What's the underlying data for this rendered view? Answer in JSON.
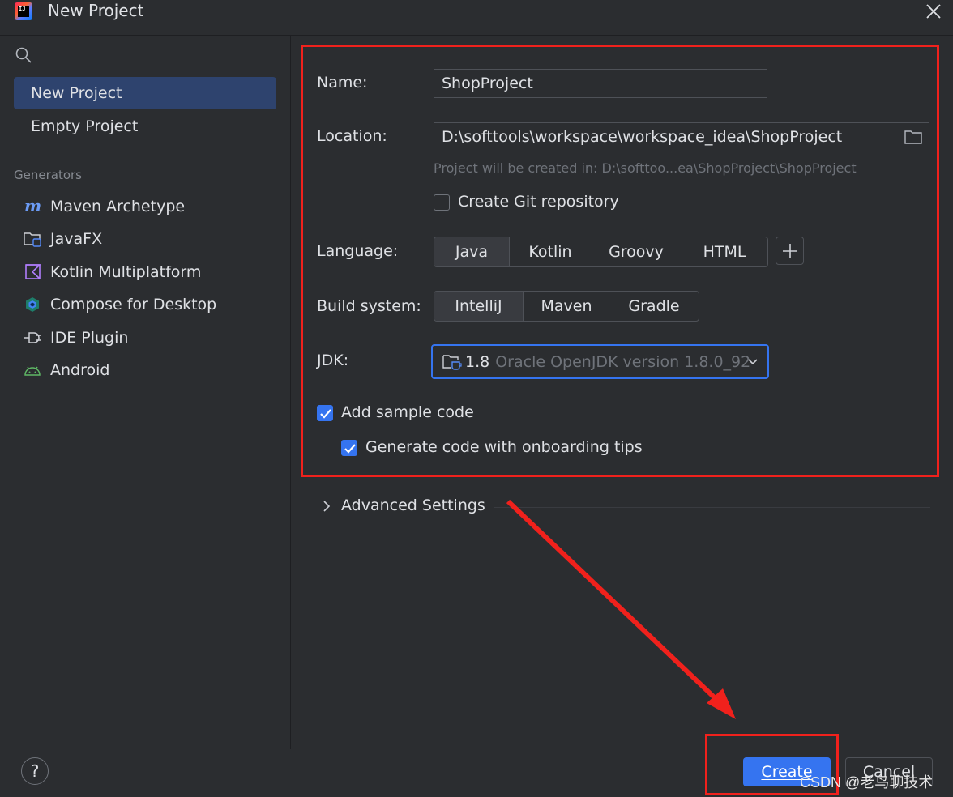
{
  "window": {
    "title": "New Project"
  },
  "sidebar": {
    "top_items": [
      {
        "label": "New Project",
        "selected": true
      },
      {
        "label": "Empty Project",
        "selected": false
      }
    ],
    "generators_label": "Generators",
    "generators": [
      {
        "label": "Maven Archetype",
        "icon": "maven-icon"
      },
      {
        "label": "JavaFX",
        "icon": "javafx-icon"
      },
      {
        "label": "Kotlin Multiplatform",
        "icon": "kotlin-icon"
      },
      {
        "label": "Compose for Desktop",
        "icon": "compose-icon"
      },
      {
        "label": "IDE Plugin",
        "icon": "plugin-icon"
      },
      {
        "label": "Android",
        "icon": "android-icon"
      }
    ]
  },
  "form": {
    "name_label": "Name:",
    "name_value": "ShopProject",
    "location_label": "Location:",
    "location_value": "D:\\softtools\\workspace\\workspace_idea\\ShopProject",
    "location_hint": "Project will be created in: D:\\softtoo...ea\\ShopProject\\ShopProject",
    "git_label": "Create Git repository",
    "git_checked": false,
    "language_label": "Language:",
    "languages": [
      "Java",
      "Kotlin",
      "Groovy",
      "HTML"
    ],
    "language_selected": "Java",
    "build_label": "Build system:",
    "build_systems": [
      "IntelliJ",
      "Maven",
      "Gradle"
    ],
    "build_selected": "IntelliJ",
    "jdk_label": "JDK:",
    "jdk_version": "1.8",
    "jdk_desc": "Oracle OpenJDK version 1.8.0_92",
    "sample_code_label": "Add sample code",
    "sample_code_checked": true,
    "onboarding_label": "Generate code with onboarding tips",
    "onboarding_checked": true,
    "advanced_label": "Advanced Settings"
  },
  "footer": {
    "help_label": "?",
    "create_label": "Create",
    "cancel_label": "Cancel",
    "watermark": "CSDN @老鸟聊技术"
  },
  "colors": {
    "accent": "#3574f0",
    "annotation_red": "#f0211c",
    "selected_bg": "#2e436e"
  }
}
